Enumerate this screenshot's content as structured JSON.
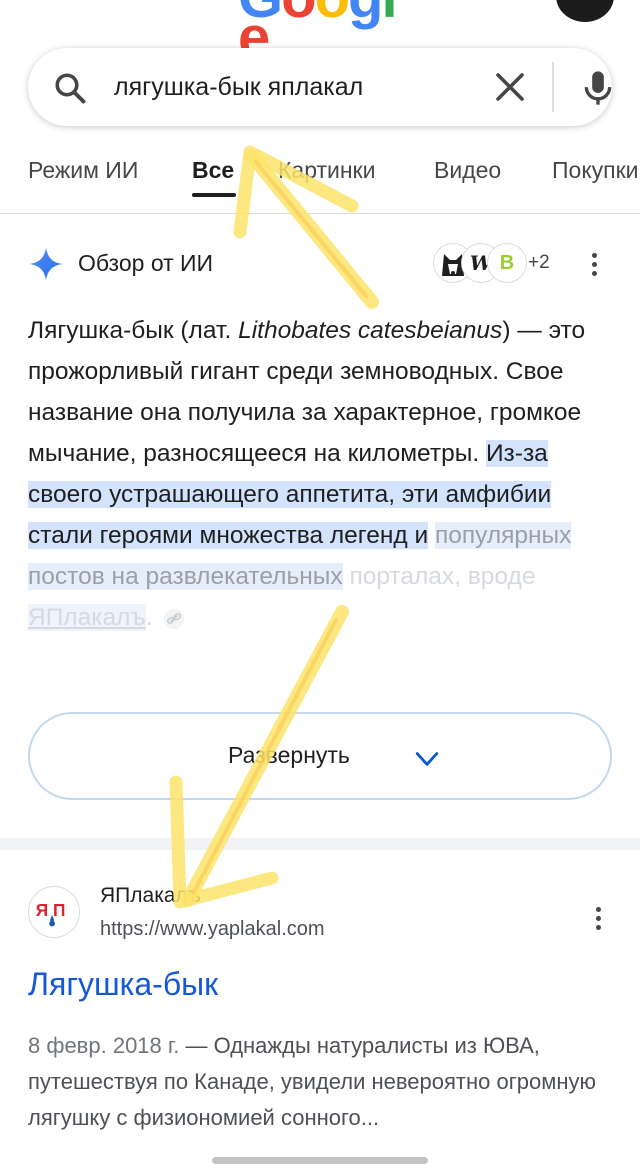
{
  "header": {
    "logo_text": "Google",
    "logo_colors": [
      "#4285f4",
      "#ea4335",
      "#fbbc05",
      "#4285f4",
      "#34a853",
      "#ea4335"
    ]
  },
  "search": {
    "query": "лягушка-бык яплакал",
    "search_icon": "search-icon",
    "clear_icon": "close-icon",
    "mic_icon": "mic-icon"
  },
  "tabs": [
    {
      "label": "Режим ИИ",
      "active": false
    },
    {
      "label": "Все",
      "active": true
    },
    {
      "label": "Картинки",
      "active": false
    },
    {
      "label": "Видео",
      "active": false
    },
    {
      "label": "Покупки",
      "active": false
    }
  ],
  "ai_overview": {
    "title": "Обзор от ИИ",
    "icon": "sparkle-icon",
    "source_count": "+2",
    "source_icons": [
      "dog-icon",
      "wb-icon",
      "b-icon"
    ],
    "text_part1": "Лягушка-бык (лат. ",
    "text_latin": "Lithobates catesbeianus",
    "text_part2": ") — это прожорливый гигант среди земноводных. Свое название она получила за характерное, громкое мычание, разносящееся на километры.",
    "highlight_1": "Из-за своего устрашающего аппетита, эти амфибии стали героями множества легенд и",
    "highlight_2": "популярных постов на развлекательных",
    "faded_prefix": "порталах, вроде ",
    "faded_link": "ЯПлакалъ",
    "faded_suffix": ".",
    "expand_label": "Развернуть"
  },
  "result": {
    "site_name": "ЯПлакалъ",
    "url": "https://www.yaplakal.com",
    "title": "Лягушка-бык",
    "date": "8 февр. 2018 г.",
    "snippet": " — Однажды натуралисты из ЮВА, путешествуя по Канаде, увидели невероятно огромную лягушку с физиономией сонного..."
  },
  "colors": {
    "link_blue": "#1558d6",
    "highlight": "#d3e3fd",
    "arrow_yellow": "#fde36a",
    "favicon_red": "#d9232e",
    "favicon_blue": "#1a5fb4"
  }
}
